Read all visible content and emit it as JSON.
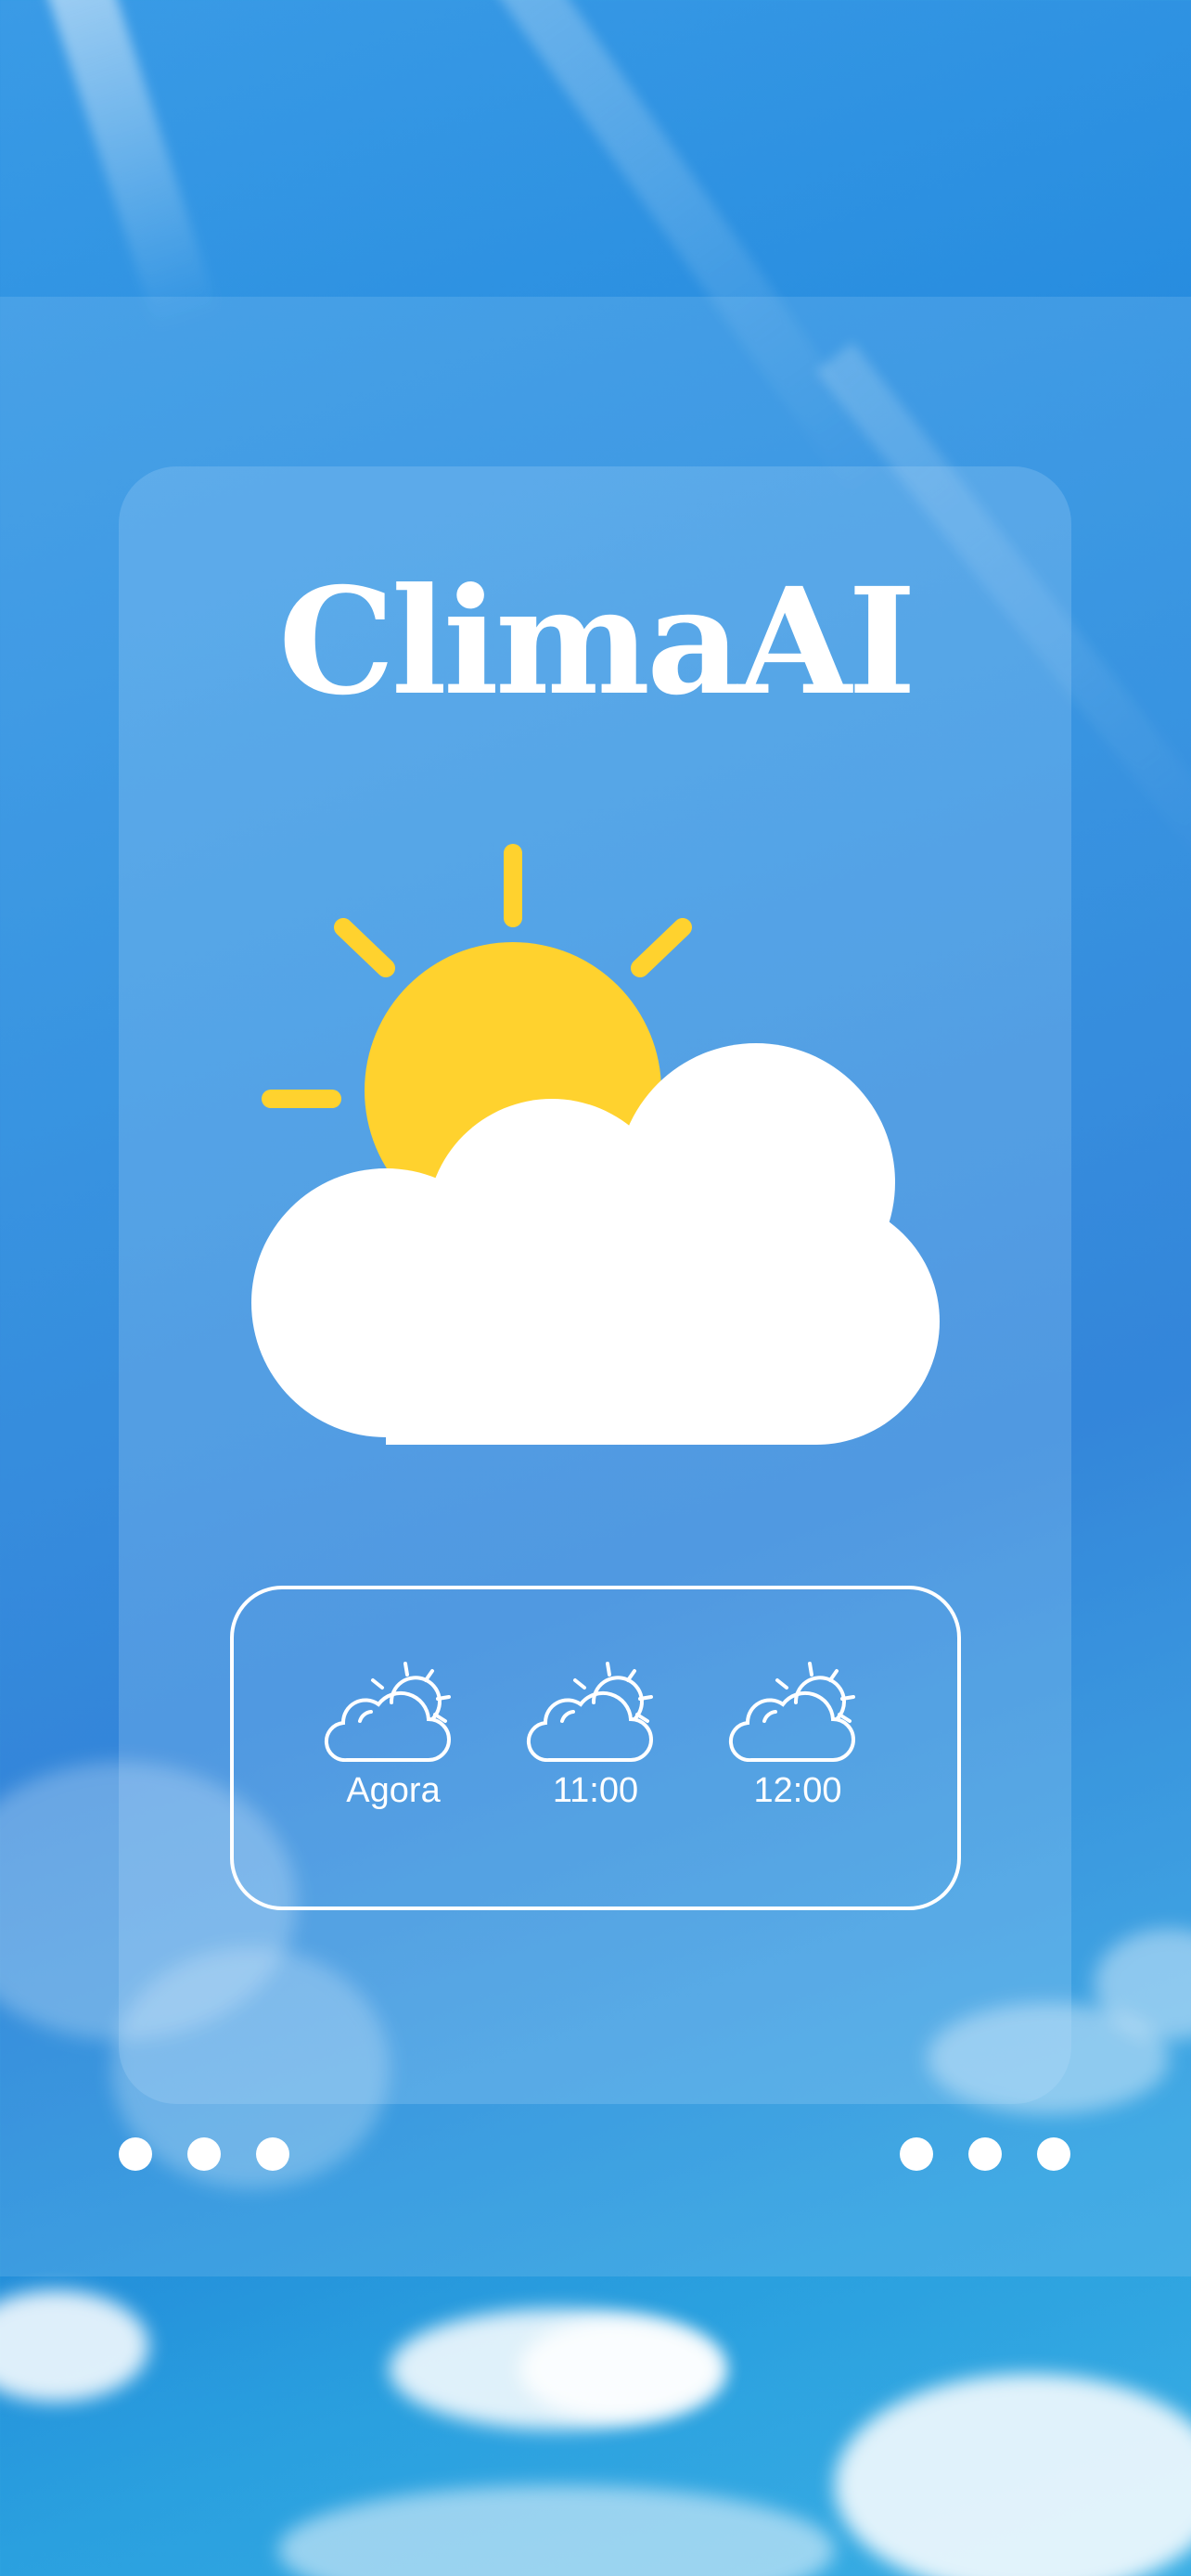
{
  "app": {
    "title": "ClimaAI"
  },
  "hero": {
    "icon": "partly-cloudy-icon"
  },
  "forecast": {
    "items": [
      {
        "label": "Agora",
        "icon": "partly-cloudy-icon"
      },
      {
        "label": "11:00",
        "icon": "partly-cloudy-icon"
      },
      {
        "label": "12:00",
        "icon": "partly-cloudy-icon"
      }
    ]
  },
  "pagination": {
    "left_dots": 3,
    "right_dots": 3
  },
  "colors": {
    "sun": "#FFD22E",
    "cloud": "#FFFFFF",
    "sky": "#1F86DC"
  }
}
